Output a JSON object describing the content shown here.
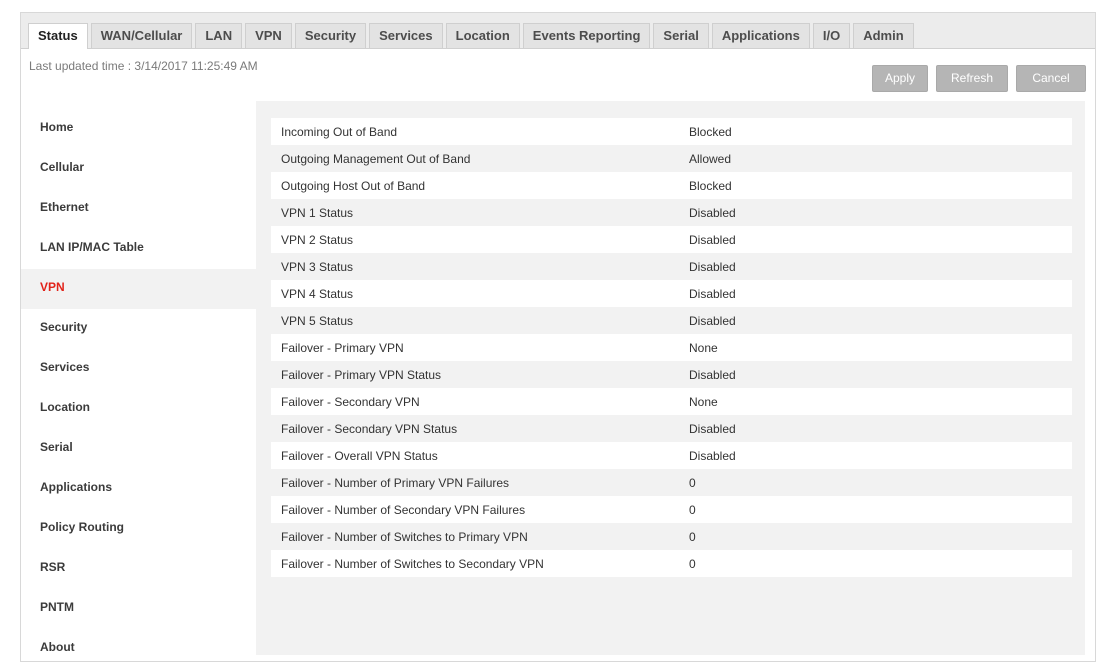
{
  "tabs": [
    {
      "label": "Status",
      "active": true
    },
    {
      "label": "WAN/Cellular",
      "active": false
    },
    {
      "label": "LAN",
      "active": false
    },
    {
      "label": "VPN",
      "active": false
    },
    {
      "label": "Security",
      "active": false
    },
    {
      "label": "Services",
      "active": false
    },
    {
      "label": "Location",
      "active": false
    },
    {
      "label": "Events Reporting",
      "active": false
    },
    {
      "label": "Serial",
      "active": false
    },
    {
      "label": "Applications",
      "active": false
    },
    {
      "label": "I/O",
      "active": false
    },
    {
      "label": "Admin",
      "active": false
    }
  ],
  "toolbar": {
    "last_updated": "Last updated time : 3/14/2017 11:25:49 AM",
    "apply_label": "Apply",
    "refresh_label": "Refresh",
    "cancel_label": "Cancel"
  },
  "sidebar": {
    "items": [
      {
        "label": "Home",
        "active": false
      },
      {
        "label": "Cellular",
        "active": false
      },
      {
        "label": "Ethernet",
        "active": false
      },
      {
        "label": "LAN IP/MAC Table",
        "active": false
      },
      {
        "label": "VPN",
        "active": true
      },
      {
        "label": "Security",
        "active": false
      },
      {
        "label": "Services",
        "active": false
      },
      {
        "label": "Location",
        "active": false
      },
      {
        "label": "Serial",
        "active": false
      },
      {
        "label": "Applications",
        "active": false
      },
      {
        "label": "Policy Routing",
        "active": false
      },
      {
        "label": "RSR",
        "active": false
      },
      {
        "label": "PNTM",
        "active": false
      },
      {
        "label": "About",
        "active": false
      }
    ]
  },
  "status_rows": [
    {
      "label": "Incoming Out of Band",
      "value": "Blocked"
    },
    {
      "label": "Outgoing Management Out of Band",
      "value": "Allowed"
    },
    {
      "label": "Outgoing Host Out of Band",
      "value": "Blocked"
    },
    {
      "label": "VPN 1 Status",
      "value": "Disabled"
    },
    {
      "label": "VPN 2 Status",
      "value": "Disabled"
    },
    {
      "label": "VPN 3 Status",
      "value": "Disabled"
    },
    {
      "label": "VPN 4 Status",
      "value": "Disabled"
    },
    {
      "label": "VPN 5 Status",
      "value": "Disabled"
    },
    {
      "label": "Failover - Primary VPN",
      "value": "None"
    },
    {
      "label": "Failover - Primary VPN Status",
      "value": "Disabled"
    },
    {
      "label": "Failover - Secondary VPN",
      "value": "None"
    },
    {
      "label": "Failover - Secondary VPN Status",
      "value": "Disabled"
    },
    {
      "label": "Failover - Overall VPN Status",
      "value": "Disabled"
    },
    {
      "label": "Failover - Number of Primary VPN Failures",
      "value": "0"
    },
    {
      "label": "Failover - Number of Secondary VPN Failures",
      "value": "0"
    },
    {
      "label": "Failover - Number of Switches to Primary VPN",
      "value": "0"
    },
    {
      "label": "Failover - Number of Switches to Secondary VPN",
      "value": "0"
    }
  ],
  "colors": {
    "active_nav": "#e2231a",
    "button_bg": "#b5b5b5",
    "content_bg": "#f2f2f2"
  }
}
